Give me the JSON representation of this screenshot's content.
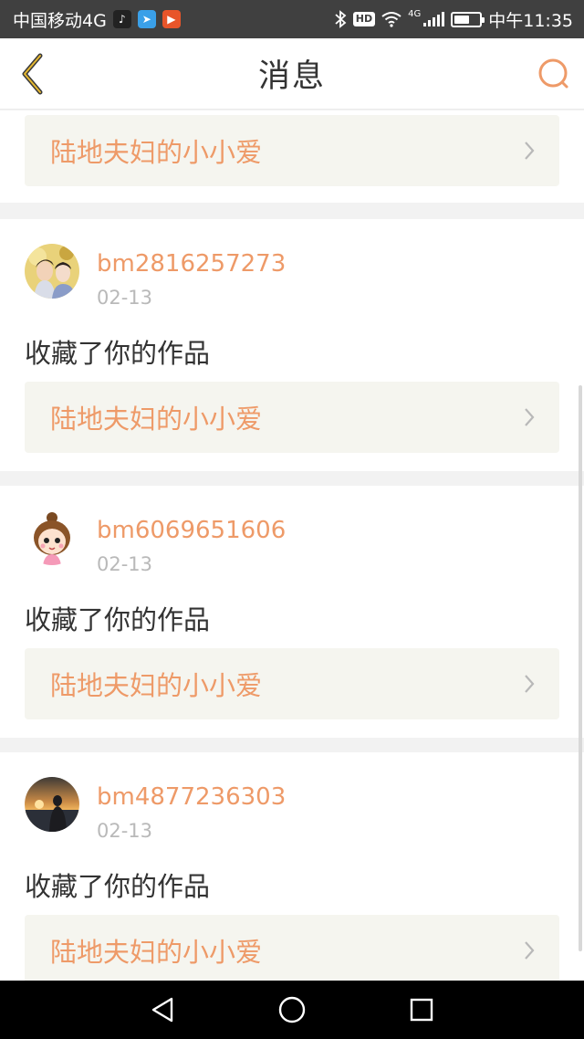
{
  "status_bar": {
    "carrier": "中国移动4G",
    "app_icons": [
      "tiktok-icon",
      "telegram-icon",
      "video-app-icon"
    ],
    "hd_badge": "HD",
    "network_tag": "4G",
    "time": "中午11:35"
  },
  "header": {
    "title": "消息",
    "back_icon": "chevron-left-icon",
    "search_icon": "search-icon"
  },
  "colors": {
    "accent": "#ee9a68",
    "work_link_bg": "#f5f5ef",
    "separator_bg": "#f2f2f2",
    "status_bar_bg": "#404040"
  },
  "top_work_link": {
    "title": "陆地夫妇的小小爱"
  },
  "messages": [
    {
      "username": "bm2816257273",
      "date": "02-13",
      "action": "收藏了你的作品",
      "work_title": "陆地夫妇的小小爱",
      "avatar": "couple-photo-avatar"
    },
    {
      "username": "bm6069651606",
      "date": "02-13",
      "action": "收藏了你的作品",
      "work_title": "陆地夫妇的小小爱",
      "avatar": "cartoon-girl-avatar"
    },
    {
      "username": "bm4877236303",
      "date": "02-13",
      "action": "收藏了你的作品",
      "work_title": "陆地夫妇的小小爱",
      "avatar": "sunset-silhouette-avatar"
    }
  ],
  "system_nav": [
    "back-triangle-icon",
    "home-circle-icon",
    "recents-square-icon"
  ]
}
